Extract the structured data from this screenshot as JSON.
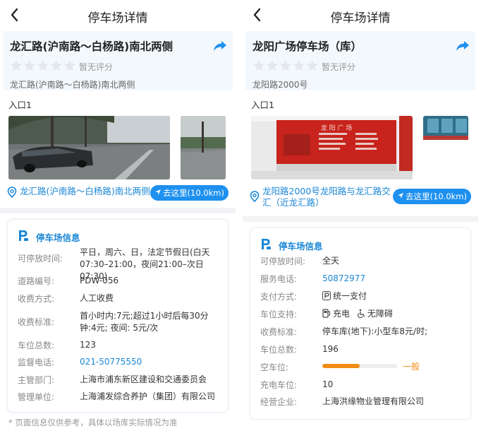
{
  "left": {
    "nav_title": "停车场详情",
    "name": "龙汇路(沪南路～白杨路)南北两侧",
    "rating_text": "暂无评分",
    "address": "龙汇路(沪南路～白杨路)南北两侧",
    "entrance": "入口1",
    "location": "龙汇路(沪南路～白杨路)南北两侧",
    "go_button": "去这里(10.0km)",
    "card_title": "停车场信息",
    "rows": [
      {
        "label": "可停放时间:",
        "value": "平日，周六、日，法定节假日(白天07:30–21:00，夜间21:00–次日07:30)"
      },
      {
        "label": "道路编号:",
        "value": "PDW-056"
      },
      {
        "label": "收费方式:",
        "value": "人工收费"
      },
      {
        "label": "收费标准:",
        "value": "首小时内:7元;超过1小时后每30分钟:4元;  夜间:  5元/次"
      },
      {
        "label": "车位总数:",
        "value": "123"
      },
      {
        "label": "监督电话:",
        "value": "021-50775550"
      },
      {
        "label": "主管部门:",
        "value": "上海市浦东新区建设和交通委员会"
      },
      {
        "label": "管理单位:",
        "value": "上海浦发综合养护（集团）有限公司"
      }
    ],
    "footnote": "* 页面信息仅供参考，具体以场库实际情况为准"
  },
  "right": {
    "nav_title": "停车场详情",
    "name": "龙阳广场停车场（库）",
    "rating_text": "暂无评分",
    "address": "龙阳路2000号",
    "entrance": "入口1",
    "location": "龙阳路2000号龙阳路与龙汇路交汇（近龙汇路）",
    "go_button": "去这里(10.0km)",
    "card_title": "停车场信息",
    "rows": [
      {
        "label": "可停放时间:",
        "value": "全天"
      },
      {
        "label": "服务电话:",
        "value": "50872977"
      },
      {
        "label": "支付方式:",
        "value": "统一支付"
      },
      {
        "label": "车位支持:",
        "value": "充电",
        "value2": "无障碍"
      },
      {
        "label": "收费标准:",
        "value": "停车库(地下):小型车8元/时;"
      },
      {
        "label": "车位总数:",
        "value": "196"
      },
      {
        "label": "空车位:",
        "value": "一般",
        "level": 0.5
      },
      {
        "label": "充电车位:",
        "value": "10"
      },
      {
        "label": "经营企业:",
        "value": "上海洪缘物业管理有限公司"
      }
    ],
    "sign_text": "龙 阳 广 场"
  },
  "colors": {
    "accent": "#1a87d6",
    "button": "#1e90ef",
    "orange": "#f08c14"
  },
  "icons": [
    "back-arrow-icon",
    "share-icon",
    "star-icon",
    "location-pin-icon",
    "navigate-arrow-icon",
    "parking-icon",
    "payment-icon",
    "charging-icon",
    "accessible-icon"
  ]
}
